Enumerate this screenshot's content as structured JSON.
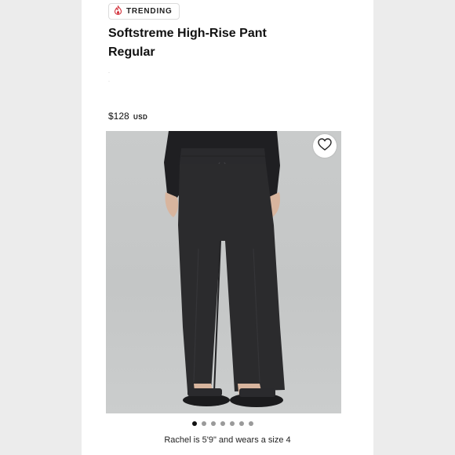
{
  "badge": {
    "label": "TRENDING",
    "icon": "flame-icon"
  },
  "product": {
    "title": "Softstreme High-Rise Pant\nRegular",
    "price": "$128",
    "currency": "USD"
  },
  "gallery": {
    "slide_count": 7,
    "active_index": 0,
    "wishlist_icon": "heart-icon"
  },
  "model_caption": "Rachel is 5'9\" and wears a size 4",
  "colors": {
    "badge_flame": "#d2323c",
    "pant": "#2b2b2d",
    "backdrop": "#c8caca"
  }
}
